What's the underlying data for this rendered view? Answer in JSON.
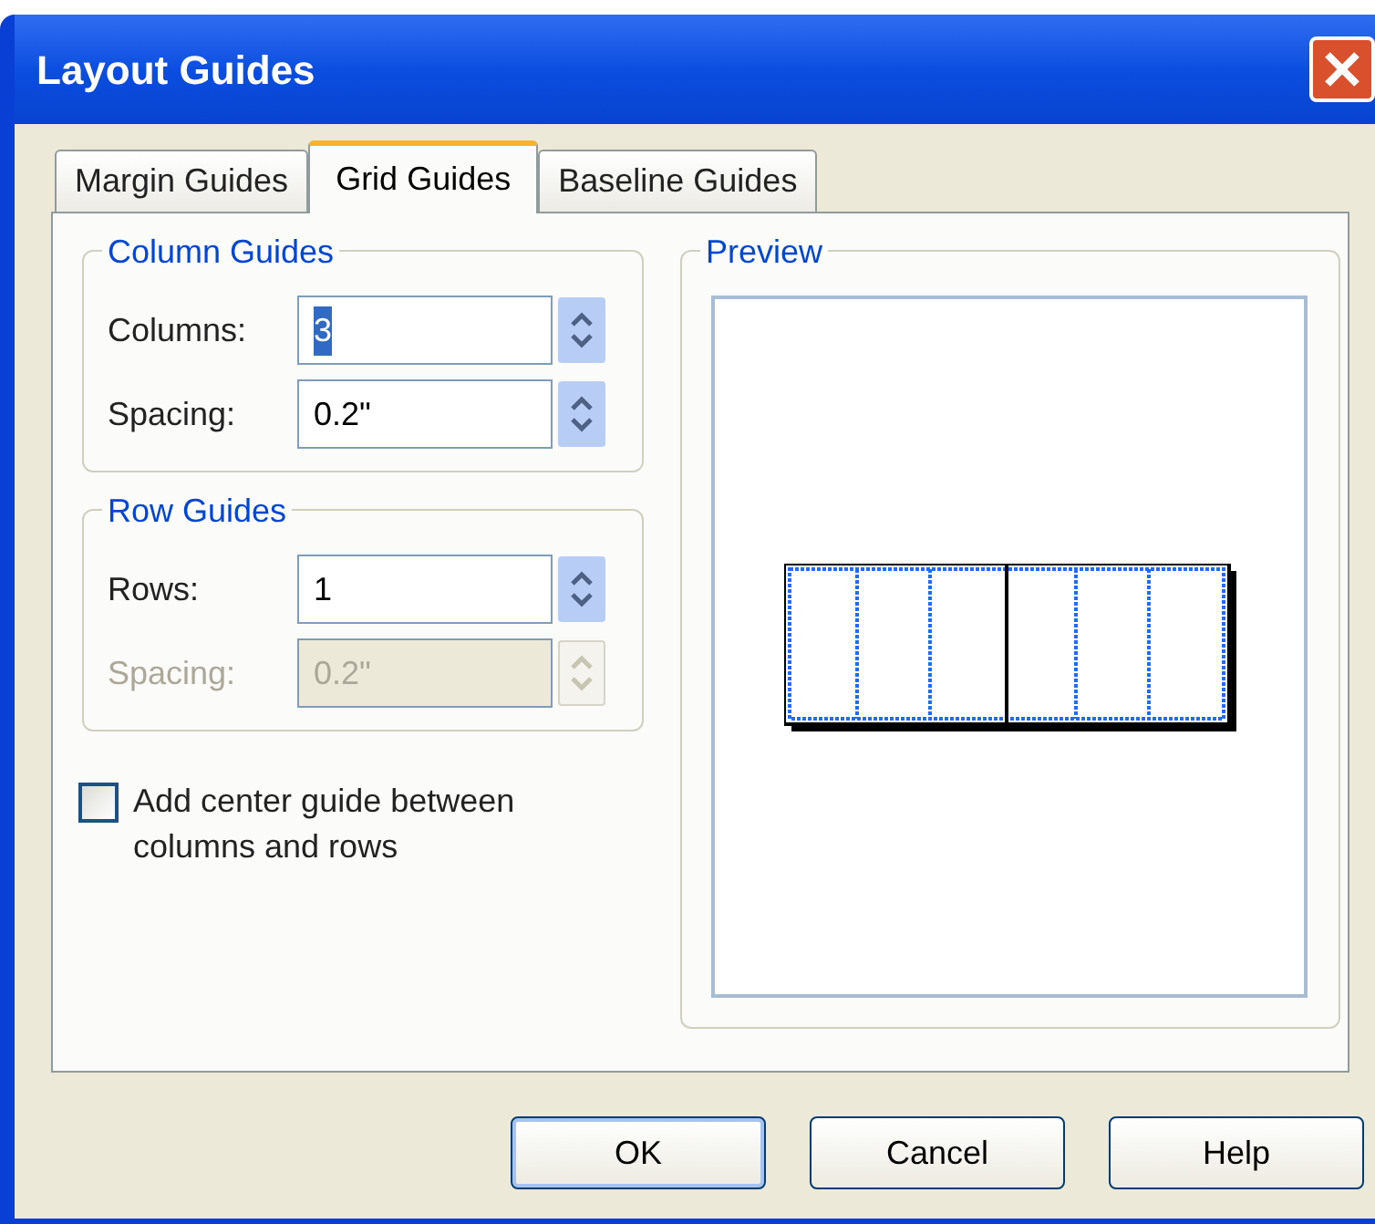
{
  "window": {
    "title": "Layout Guides"
  },
  "tabs": [
    {
      "label": "Margin Guides",
      "selected": false
    },
    {
      "label": "Grid Guides",
      "selected": true
    },
    {
      "label": "Baseline Guides",
      "selected": false
    }
  ],
  "column_guides": {
    "title": "Column Guides",
    "fields": [
      {
        "label": "Columns:",
        "value": "3",
        "text_selected": true,
        "disabled": false
      },
      {
        "label": "Spacing:",
        "value": "0.2\"",
        "text_selected": false,
        "disabled": false
      }
    ]
  },
  "row_guides": {
    "title": "Row Guides",
    "fields": [
      {
        "label": "Rows:",
        "value": "1",
        "text_selected": false,
        "disabled": false
      },
      {
        "label": "Spacing:",
        "value": "0.2\"",
        "text_selected": false,
        "disabled": true
      }
    ]
  },
  "center_guide": {
    "label": "Add center guide between columns and rows",
    "checked": false
  },
  "preview": {
    "title": "Preview"
  },
  "buttons": [
    {
      "label": "OK",
      "default": true
    },
    {
      "label": "Cancel",
      "default": false
    },
    {
      "label": "Help",
      "default": false
    }
  ]
}
